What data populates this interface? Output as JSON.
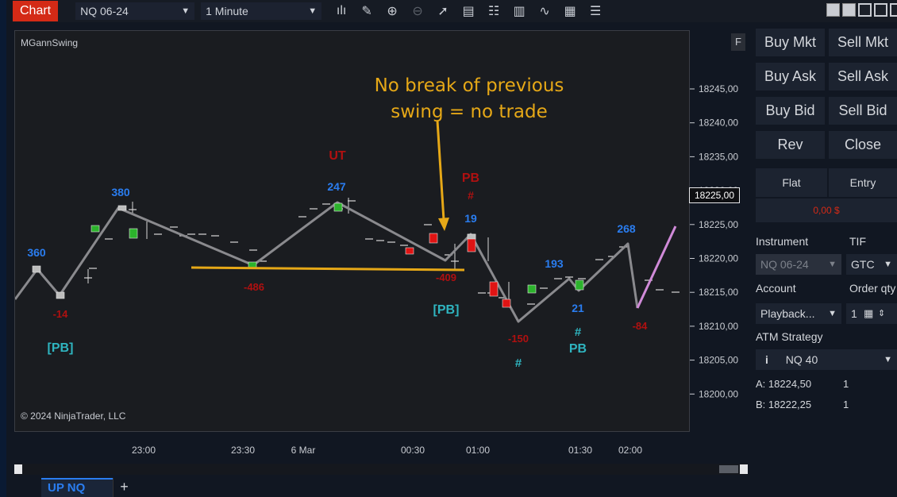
{
  "toolbar": {
    "chart_tab": "Chart",
    "instrument": "NQ 06-24",
    "interval": "1 Minute",
    "icons": [
      "bar-type-icon",
      "drawing-tool-icon",
      "zoom-in-icon",
      "zoom-out-icon",
      "pointer-icon",
      "data-box-icon",
      "properties-icon",
      "strategies-icon",
      "indicators-icon",
      "templates-icon",
      "more-icon"
    ]
  },
  "chart": {
    "indicator_label": "MGannSwing",
    "copyright": "© 2024 NinjaTrader, LLC",
    "f_button": "F",
    "current_price": "18225,00",
    "annotation": "No break of previous\nswing = no trade",
    "annotation_line1": "No break of previous",
    "annotation_line2": "swing = no trade",
    "colors": {
      "swing_line": "#8a8a8e",
      "up_bar": "#2cb32c",
      "down_bar": "#e01414",
      "blue_label": "#2a7df0",
      "red_label": "#b01010",
      "teal_label": "#2fb5c0",
      "annotation": "#e6a817",
      "projection": "#d08ad8"
    }
  },
  "chart_data": {
    "type": "line",
    "y_ticks": [
      "18245,00",
      "18240,00",
      "18235,00",
      "18230,00",
      "18225,00",
      "18220,00",
      "18215,00",
      "18210,00",
      "18205,00",
      "18200,00"
    ],
    "x_ticks": [
      "23:00",
      "23:30",
      "6 Mar",
      "00:30",
      "01:00",
      "01:30",
      "02:00"
    ],
    "ylim": [
      18195.5,
      18250
    ],
    "swing_labels": [
      {
        "text": "360",
        "color": "blue"
      },
      {
        "text": "-14",
        "color": "red"
      },
      {
        "text": "[PB]",
        "color": "teal"
      },
      {
        "text": "380",
        "color": "blue"
      },
      {
        "text": "-486",
        "color": "red"
      },
      {
        "text": "UT",
        "color": "red"
      },
      {
        "text": "247",
        "color": "blue"
      },
      {
        "text": "-409",
        "color": "red"
      },
      {
        "text": "[PB]",
        "color": "teal"
      },
      {
        "text": "PB",
        "color": "red"
      },
      {
        "text": "#",
        "color": "red"
      },
      {
        "text": "19",
        "color": "blue"
      },
      {
        "text": "-150",
        "color": "red"
      },
      {
        "text": "#",
        "color": "teal"
      },
      {
        "text": "193",
        "color": "blue"
      },
      {
        "text": "21",
        "color": "blue"
      },
      {
        "text": "#",
        "color": "teal"
      },
      {
        "text": "PB",
        "color": "teal"
      },
      {
        "text": "268",
        "color": "blue"
      },
      {
        "text": "-84",
        "color": "red"
      }
    ]
  },
  "bottom_tabs": {
    "active": "UP NQ",
    "add": "+"
  },
  "order_panel": {
    "buy_mkt": "Buy Mkt",
    "sell_mkt": "Sell Mkt",
    "buy_ask": "Buy Ask",
    "sell_ask": "Sell Ask",
    "buy_bid": "Buy Bid",
    "sell_bid": "Sell Bid",
    "rev": "Rev",
    "close": "Close",
    "position": "Flat",
    "entry": "Entry",
    "pnl": "0,00 $",
    "instrument_label": "Instrument",
    "instrument_value": "NQ 06-24",
    "tif_label": "TIF",
    "tif_value": "GTC",
    "account_label": "Account",
    "account_value": "Playback...",
    "order_qty_label": "Order qty",
    "order_qty_value": "1",
    "atm_label": "ATM Strategy",
    "atm_value": "NQ 40",
    "atm_info": "i",
    "ask_row": "A:  18224,50",
    "ask_qty": "1",
    "bid_row": "B:  18222,25",
    "bid_qty": "1"
  }
}
